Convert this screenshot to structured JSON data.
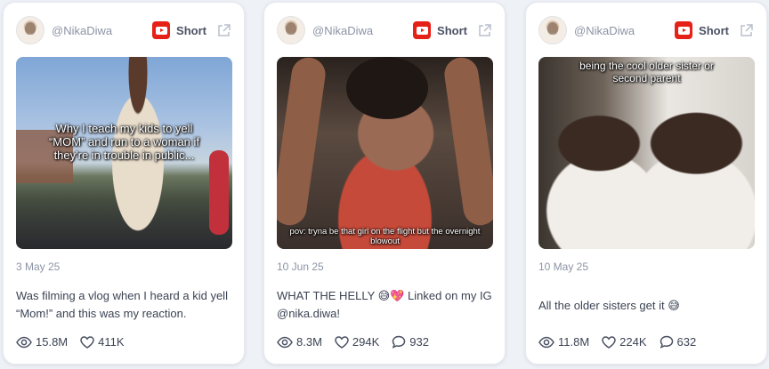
{
  "cards": [
    {
      "handle": "@NikaDiwa",
      "type_label": "Short",
      "platform_icon": "youtube-icon",
      "overlay_text": "Why I teach my kids to yell “MOM” and run to a woman if they're in trouble in public...",
      "date": "3 May 25",
      "caption": "Was filming a vlog when I heard a kid yell “Mom!” and this was my reaction.",
      "views": "15.8M",
      "likes": "411K",
      "comments": null
    },
    {
      "handle": "@NikaDiwa",
      "type_label": "Short",
      "platform_icon": "youtube-icon",
      "overlay_text": "pov: tryna be that girl on the flight but the overnight blowout",
      "date": "10 Jun 25",
      "caption": "WHAT THE HELLY 😅💖 Linked on my IG @nika.diwa!",
      "views": "8.3M",
      "likes": "294K",
      "comments": "932"
    },
    {
      "handle": "@NikaDiwa",
      "type_label": "Short",
      "platform_icon": "youtube-icon",
      "overlay_text": "being the cool older sister or second parent",
      "date": "10 May 25",
      "caption": "All the older sisters get it 😅",
      "views": "11.8M",
      "likes": "224K",
      "comments": "632"
    }
  ],
  "colors": {
    "youtube_red": "#e62117",
    "card_bg": "#ffffff",
    "page_bg": "#eef1f6",
    "muted_text": "#8b93a4"
  }
}
